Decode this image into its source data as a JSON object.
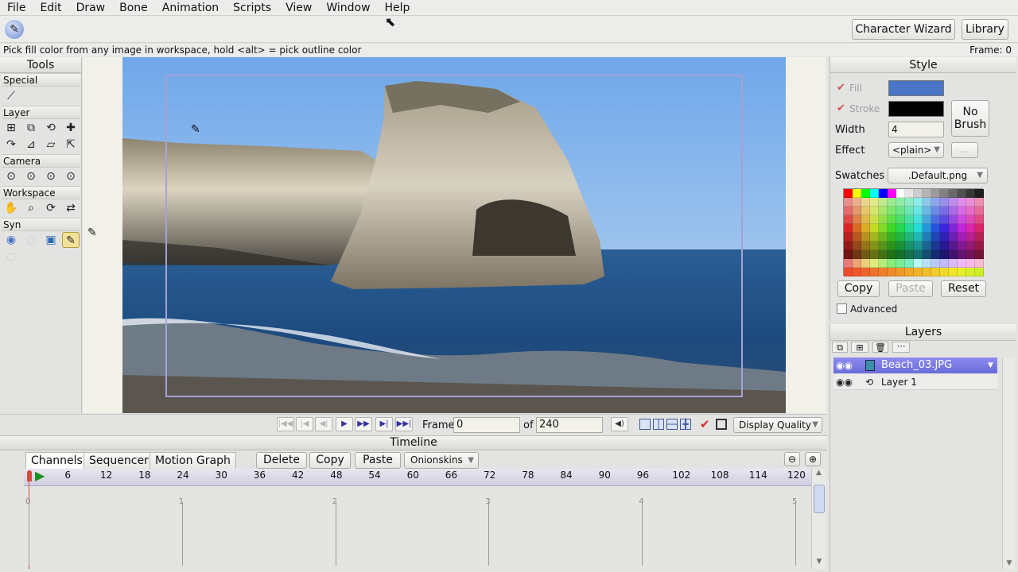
{
  "menu": [
    "File",
    "Edit",
    "Draw",
    "Bone",
    "Animation",
    "Scripts",
    "View",
    "Window",
    "Help"
  ],
  "toolbar": {
    "character_wizard": "Character Wizard",
    "library": "Library",
    "frame_display": "Frame: 0"
  },
  "status": {
    "hint": "Pick fill color from any image in workspace, hold <alt> = pick outline color"
  },
  "tools": {
    "title": "Tools",
    "categories": [
      "Special",
      "Layer",
      "Camera",
      "Workspace",
      "Syn"
    ]
  },
  "playback": {
    "frame_label": "Frame",
    "frame_value": "0",
    "of_label": "of",
    "total_frames": "240",
    "display_quality": "Display Quality"
  },
  "timeline": {
    "title": "Timeline",
    "tabs": [
      "Channels",
      "Sequencer",
      "Motion Graph"
    ],
    "buttons": {
      "delete": "Delete",
      "copy": "Copy",
      "paste": "Paste",
      "onionskins": "Onionskins"
    },
    "ruler_ticks": [
      "6",
      "12",
      "18",
      "24",
      "30",
      "36",
      "42",
      "48",
      "54",
      "60",
      "66",
      "72",
      "78",
      "84",
      "90",
      "96",
      "102",
      "108",
      "114",
      "120"
    ],
    "second_markers": [
      "0",
      "1",
      "2",
      "3",
      "4",
      "5"
    ]
  },
  "style": {
    "title": "Style",
    "fill_label": "Fill",
    "stroke_label": "Stroke",
    "fill_color": "#4a74c4",
    "stroke_color": "#000000",
    "no_brush": "No Brush",
    "width_label": "Width",
    "width_value": "4",
    "effect_label": "Effect",
    "effect_value": "<plain>",
    "effect_more": "...",
    "swatches_label": "Swatches",
    "swatches_value": ".Default.png",
    "copy": "Copy",
    "paste": "Paste",
    "reset": "Reset",
    "advanced": "Advanced"
  },
  "layers": {
    "title": "Layers",
    "items": [
      {
        "name": "Beach_03.JPG",
        "selected": true
      },
      {
        "name": "Layer 1",
        "selected": false
      }
    ]
  }
}
